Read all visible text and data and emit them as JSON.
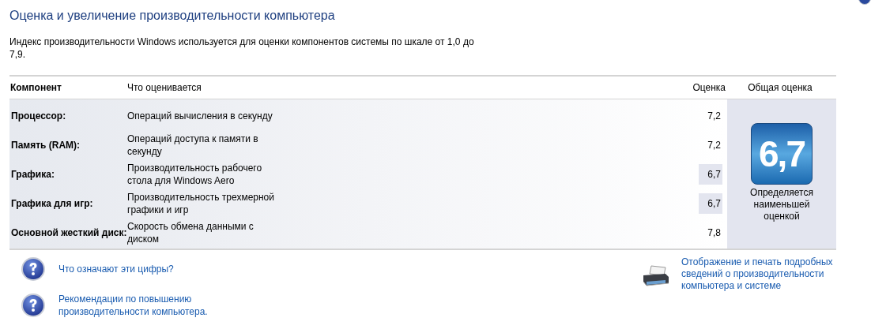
{
  "title": "Оценка и увеличение производительности компьютера",
  "description": "Индекс производительности Windows используется для оценки компонентов системы по шкале от 1,0 до 7,9.",
  "table": {
    "columns": [
      "Компонент",
      "Что оценивается",
      "Оценка",
      "Общая оценка"
    ],
    "rows": [
      {
        "component": "Процессор:",
        "rated": "Операций вычисления в секунду",
        "score": "7,2",
        "highlighted": false
      },
      {
        "component": "Память (RAM):",
        "rated": "Операций доступа к памяти в секунду",
        "score": "7,2",
        "highlighted": false
      },
      {
        "component": "Графика:",
        "rated": "Производительность рабочего стола для Windows Aero",
        "score": "6,7",
        "highlighted": true
      },
      {
        "component": "Графика для игр:",
        "rated": "Производительность трехмерной графики и игр",
        "score": "6,7",
        "highlighted": true
      },
      {
        "component": "Основной жесткий диск:",
        "rated": "Скорость обмена данными с диском",
        "score": "7,8",
        "highlighted": false
      }
    ],
    "overall": {
      "badge": "6,7",
      "caption": "Определяется наименьшей оценкой"
    }
  },
  "links": [
    {
      "kind": "help",
      "text": "Что означают эти цифры?"
    },
    {
      "kind": "help",
      "text": "Рекомендации по повышению производительности компьютера."
    },
    {
      "kind": "print",
      "text": "Отображение и печать подробных сведений о производительности компьютера и системе"
    }
  ]
}
